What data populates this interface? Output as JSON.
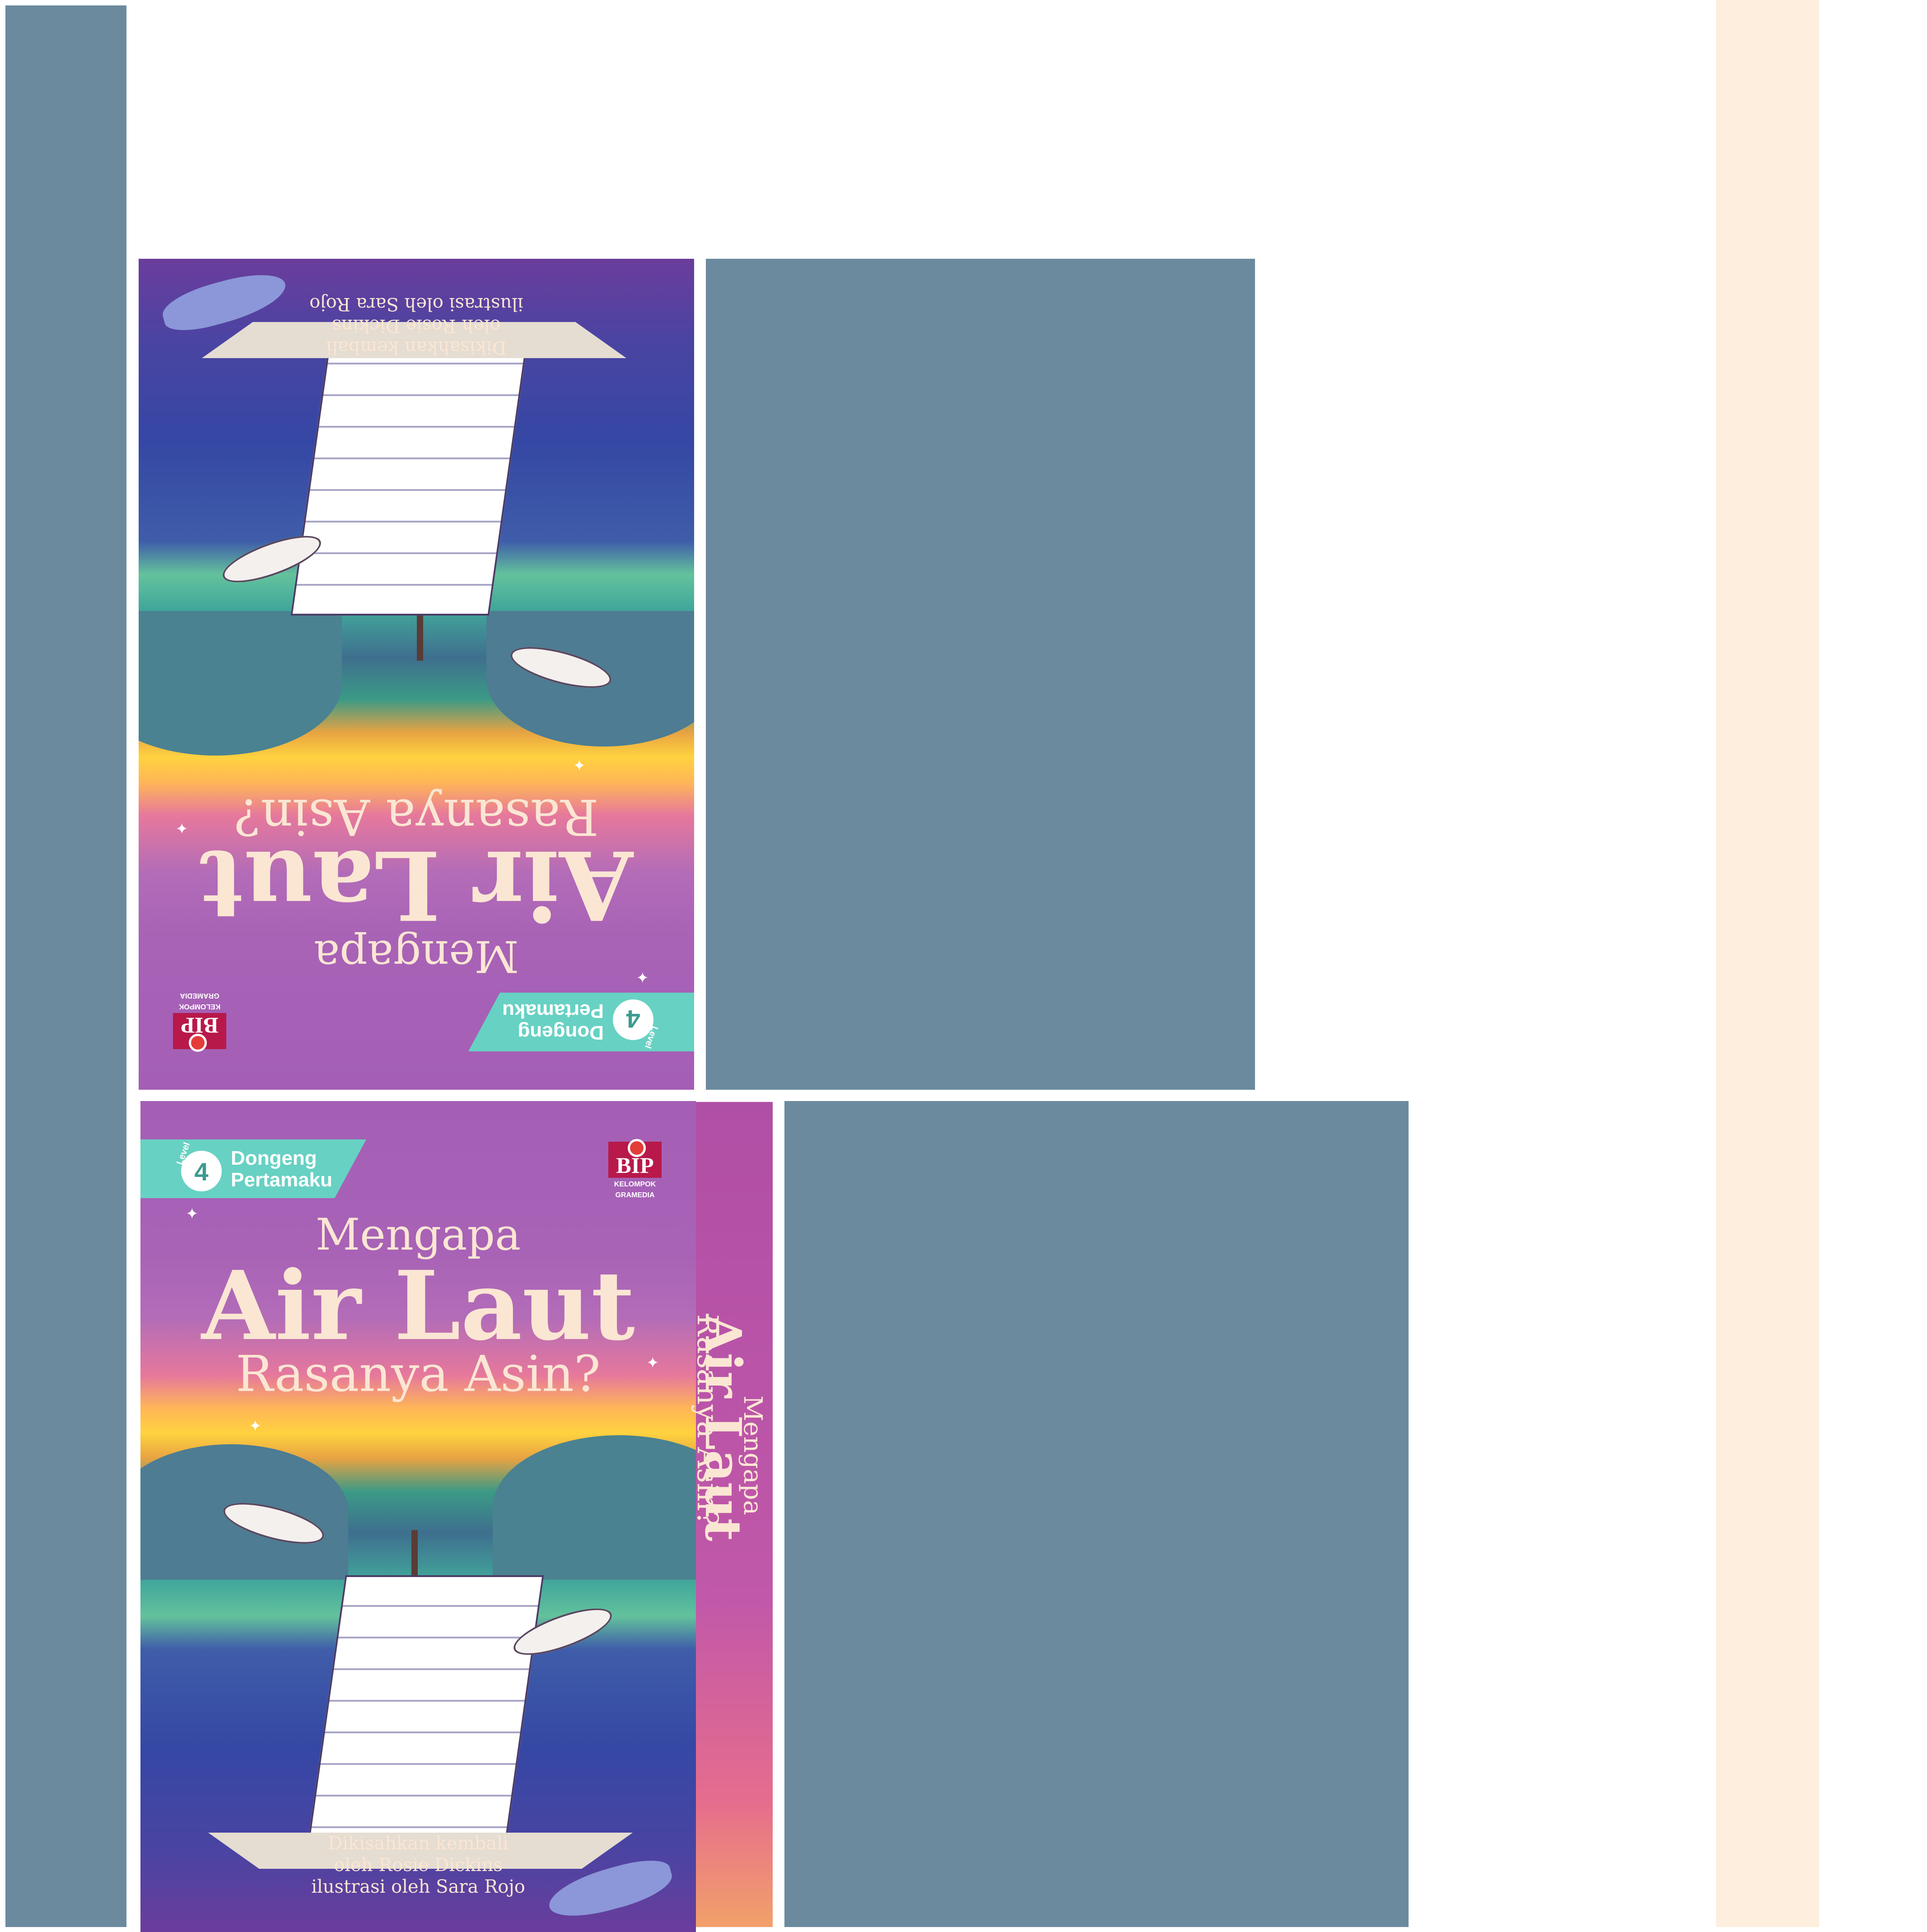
{
  "colors": {
    "slate_panel": "#6b8a9e",
    "cream_bar": "#feeedd",
    "badge_teal": "#67d1c3",
    "title_cream": "#fbe6d3",
    "publisher_red": "#b8194a"
  },
  "book": {
    "badge": {
      "level_label": "Level",
      "level_number": "4",
      "series_line1": "Dongeng",
      "series_line2": "Pertamaku"
    },
    "publisher": {
      "logo_text": "BIP",
      "sub_line1": "KELOMPOK",
      "sub_line2": "GRAMEDIA"
    },
    "title": {
      "line1": "Mengapa",
      "line2": "Air Laut",
      "line3": "Rasanya Asin?"
    },
    "credits": {
      "line1": "Dikisahkan kembali",
      "line2": "oleh Rosie Dickins",
      "line3": "ilustrasi oleh Sara Rojo"
    }
  },
  "back_cover": {
    "badge": {
      "level_label": "Level",
      "level_number": "4",
      "series_line1": "Dongeng",
      "series_line2": "Pertamaku"
    },
    "publisher": {
      "logo_text": "BIP",
      "sub_line1": "KELOMPOK",
      "sub_line2": "GRAMEDIA"
    },
    "title": {
      "line1": "Mengapa",
      "line2": "Air Laut",
      "line3": "Rasanya Asin?"
    },
    "credits": {
      "line1": "Dikisahkan kembali",
      "line2": "oleh Rosie Dickins",
      "line3": "ilustrasi oleh Sara Rojo"
    }
  },
  "spine": {
    "line1": "Mengapa",
    "line2": "Air Laut",
    "line3": "Rasanya Asin?"
  }
}
